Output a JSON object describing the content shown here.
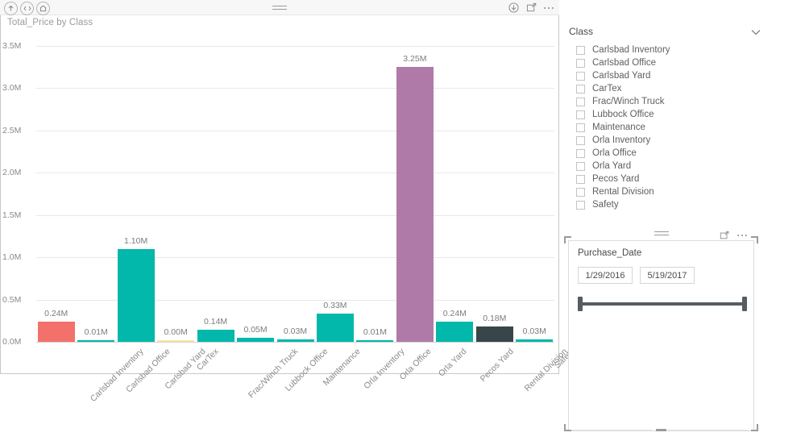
{
  "chart_visual": {
    "title": "Total_Price by Class",
    "header": {
      "left_icons": [
        "drill-up-icon",
        "expand-hierarchy-icon",
        "drill-down-icon"
      ],
      "right_icons": [
        "filter-download-icon",
        "focus-mode-icon",
        "more-options-icon"
      ],
      "grip": "drag-grip-icon"
    }
  },
  "chart_data": {
    "type": "bar",
    "title": "Total_Price by Class",
    "xlabel": "",
    "ylabel": "",
    "ylim": [
      0,
      3500000
    ],
    "ytick_labels": [
      "0.0M",
      "0.5M",
      "1.0M",
      "1.5M",
      "2.0M",
      "2.5M",
      "3.0M",
      "3.5M"
    ],
    "ytick_values": [
      0,
      500000,
      1000000,
      1500000,
      2000000,
      2500000,
      3000000,
      3500000
    ],
    "grid": true,
    "legend": "none",
    "categories": [
      "Carlsbad Inventory",
      "Carlsbad Office",
      "Carlsbad Yard",
      "CarTex",
      "Frac/Winch Truck",
      "Lubbock Office",
      "Maintenance",
      "Orla Inventory",
      "Orla Office",
      "Orla Yard",
      "Pecos Yard",
      "Rental Division",
      "Safety"
    ],
    "values": [
      240000,
      10000,
      1100000,
      2000,
      140000,
      50000,
      30000,
      330000,
      10000,
      3250000,
      240000,
      180000,
      30000
    ],
    "data_labels": [
      "0.24M",
      "0.01M",
      "1.10M",
      "0.00M",
      "0.14M",
      "0.05M",
      "0.03M",
      "0.33M",
      "0.01M",
      "3.25M",
      "0.24M",
      "0.18M",
      "0.03M"
    ],
    "bar_colors": [
      "#F4706B",
      "#01B8AA",
      "#01B8AA",
      "#FBE5A0",
      "#01B8AA",
      "#01B8AA",
      "#01B8AA",
      "#01B8AA",
      "#01B8AA",
      "#B07AA8",
      "#01B8AA",
      "#374649",
      "#01B8AA"
    ]
  },
  "class_slicer": {
    "title": "Class",
    "chevron": "chevron-down-icon",
    "items": [
      {
        "label": "Carlsbad Inventory",
        "checked": false
      },
      {
        "label": "Carlsbad Office",
        "checked": false
      },
      {
        "label": "Carlsbad Yard",
        "checked": false
      },
      {
        "label": "CarTex",
        "checked": false
      },
      {
        "label": "Frac/Winch Truck",
        "checked": false
      },
      {
        "label": "Lubbock Office",
        "checked": false
      },
      {
        "label": "Maintenance",
        "checked": false
      },
      {
        "label": "Orla Inventory",
        "checked": false
      },
      {
        "label": "Orla Office",
        "checked": false
      },
      {
        "label": "Orla Yard",
        "checked": false
      },
      {
        "label": "Pecos Yard",
        "checked": false
      },
      {
        "label": "Rental Division",
        "checked": false
      },
      {
        "label": "Safety",
        "checked": false
      }
    ]
  },
  "date_slicer": {
    "title": "Purchase_Date",
    "start_date": "1/29/2016",
    "end_date": "5/19/2017",
    "header": {
      "right_icons": [
        "focus-mode-icon",
        "more-options-icon"
      ],
      "grip": "drag-grip-icon"
    },
    "selected": true
  },
  "colors": {
    "teal": "#01B8AA",
    "salmon": "#F4706B",
    "purple": "#B07AA8",
    "charcoal": "#374649",
    "pale_yellow": "#FBE5A0"
  }
}
